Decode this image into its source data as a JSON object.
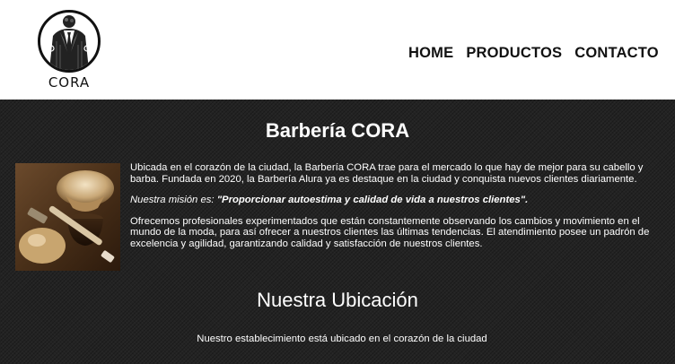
{
  "header": {
    "logo_text": "CORA",
    "nav": [
      "HOME",
      "PRODUCTOS",
      "CONTACTO"
    ]
  },
  "about": {
    "title": "Barbería CORA",
    "paragraph1": "Ubicada en el corazón de la ciudad, la Barbería CORA trae para el mercado lo que hay de mejor para su cabello y barba. Fundada en 2020, la Barbería Alura ya es destaque en la ciudad y conquista nuevos clientes diariamente.",
    "mission_label": "Nuestra misión es: ",
    "mission_quote": "\"Proporcionar autoestima y calidad de vida a nuestros clientes\".",
    "paragraph3": "Ofrecemos profesionales experimentados que están constantemente observando los cambios y movimiento en el mundo de la moda, para así ofrecer a nuestros clientes las últimas tendencias. El atendimiento posee un padrón de excelencia y agilidad, garantizando calidad y satisfacción de nuestros clientes."
  },
  "location": {
    "title": "Nuestra Ubicación",
    "text": "Nuestro establecimiento está ubicado en el corazón de la ciudad"
  },
  "colors": {
    "header_bg": "#ffffff",
    "page_bg": "#232323",
    "text": "#ffffff",
    "nav_text": "#111111"
  }
}
